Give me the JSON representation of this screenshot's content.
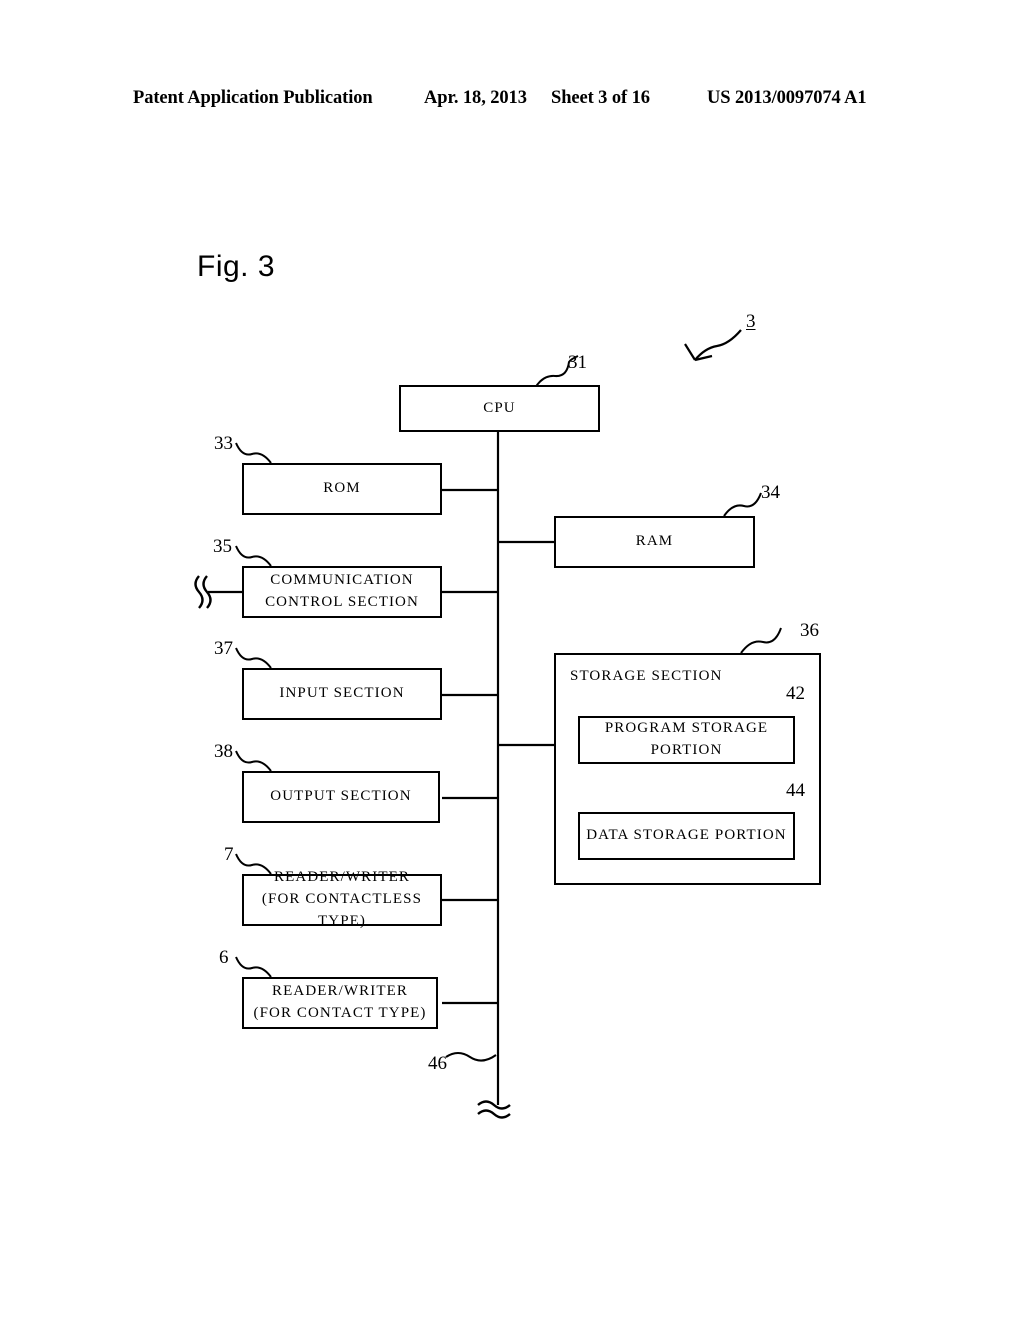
{
  "header": {
    "publication": "Patent Application Publication",
    "date": "Apr. 18, 2013",
    "sheet": "Sheet 3 of 16",
    "patent_number": "US 2013/0097074 A1"
  },
  "figure": {
    "label": "Fig. 3",
    "assembly_ref": "3"
  },
  "blocks": {
    "cpu": {
      "label": "CPU",
      "ref": "31"
    },
    "rom": {
      "label": "ROM",
      "ref": "33"
    },
    "ram": {
      "label": "RAM",
      "ref": "34"
    },
    "communication_control": {
      "label": "COMMUNICATION\nCONTROL SECTION",
      "ref": "35"
    },
    "input_section": {
      "label": "INPUT SECTION",
      "ref": "37"
    },
    "output_section": {
      "label": "OUTPUT SECTION",
      "ref": "38"
    },
    "reader_writer_contactless": {
      "label": "READER/WRITER\n(FOR CONTACTLESS TYPE)",
      "ref": "7"
    },
    "reader_writer_contact": {
      "label": "READER/WRITER\n(FOR CONTACT TYPE)",
      "ref": "6"
    },
    "storage_section": {
      "label": "STORAGE SECTION",
      "ref": "36"
    },
    "program_storage_portion": {
      "label": "PROGRAM STORAGE PORTION",
      "ref": "42"
    },
    "data_storage_portion": {
      "label": "DATA STORAGE PORTION",
      "ref": "44"
    }
  },
  "bus": {
    "ref": "46"
  },
  "icons": {
    "antenna": "antenna-wave-icon",
    "bus_break": "line-break-icon",
    "lead_arrow": "curved-arrow-icon"
  },
  "colors": {
    "ink": "#000000",
    "paper": "#ffffff"
  }
}
